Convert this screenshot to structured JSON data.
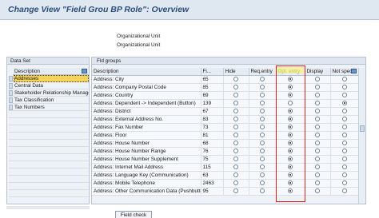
{
  "window": {
    "title": "Change View \"Field Grou BP Role\": Overview"
  },
  "org_unit": {
    "line1": "Organizational Unit",
    "line2": "Organizational Unit"
  },
  "data_set": {
    "title": "Data Set",
    "column": "Description",
    "items": [
      {
        "label": "Addresses",
        "active": true
      },
      {
        "label": "Central Data"
      },
      {
        "label": "Stakeholder Relationship Manage"
      },
      {
        "label": "Tax Classification"
      },
      {
        "label": "Tax Numbers"
      }
    ]
  },
  "field_groups": {
    "title": "Fld groups",
    "columns": [
      "Description",
      "Fi...",
      "Hide",
      "Req.entry",
      "Opt. entry",
      "Display",
      "Not spec."
    ],
    "rows": [
      {
        "desc": "Address: City",
        "num": "65",
        "sel": 2
      },
      {
        "desc": "Address: Company Postal Code",
        "num": "85",
        "sel": 2
      },
      {
        "desc": "Address: Country",
        "num": "69",
        "sel": 2
      },
      {
        "desc": "Address: Dependent -> Independent (Button)",
        "num": "139",
        "sel": 4
      },
      {
        "desc": "Address: District",
        "num": "67",
        "sel": 2
      },
      {
        "desc": "Address: External Address No.",
        "num": "83",
        "sel": 2
      },
      {
        "desc": "Address: Fax Number",
        "num": "73",
        "sel": 2
      },
      {
        "desc": "Address: Floor",
        "num": "81",
        "sel": 2
      },
      {
        "desc": "Address: House Number",
        "num": "68",
        "sel": 2
      },
      {
        "desc": "Address: House Number Range",
        "num": "76",
        "sel": 2
      },
      {
        "desc": "Address: House Number Supplement",
        "num": "75",
        "sel": 2
      },
      {
        "desc": "Address: Internet Mail Address",
        "num": "115",
        "sel": 2
      },
      {
        "desc": "Address: Language Key (Communication)",
        "num": "63",
        "sel": 2
      },
      {
        "desc": "Address: Mobile Telephone",
        "num": "2463",
        "sel": 2
      },
      {
        "desc": "Address: Other Communication Data (Pushbutton)",
        "num": "95",
        "sel": 2
      }
    ]
  },
  "buttons": {
    "field_check": "Field check"
  },
  "colors": {
    "title_text": "#2a4d7a",
    "active_item": "#f7d35a",
    "highlight_box": "#e0211a",
    "header_highlight": "#f7f38a"
  }
}
